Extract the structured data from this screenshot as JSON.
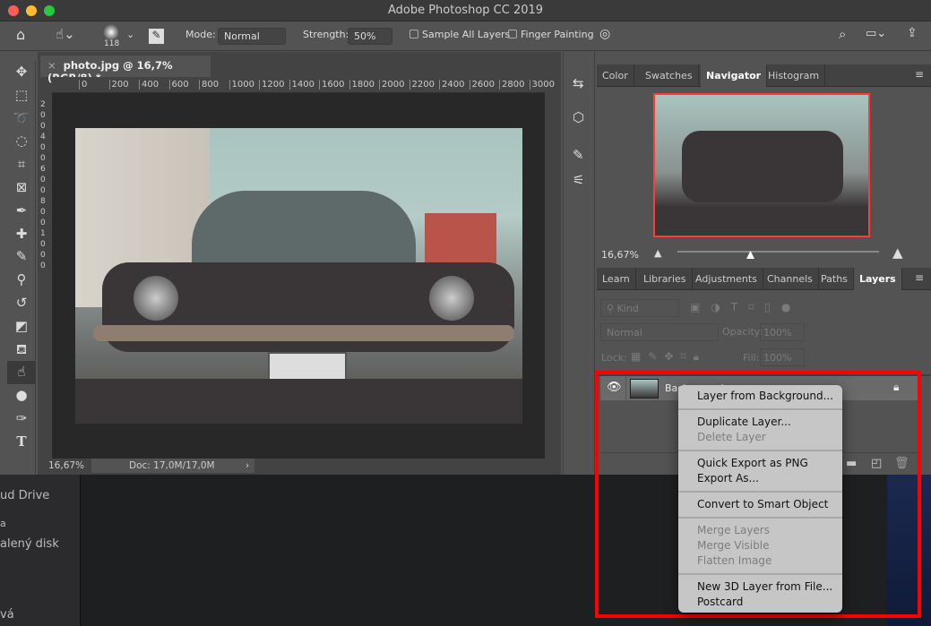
{
  "window": {
    "title": "Adobe Photoshop CC 2019"
  },
  "options": {
    "brush_size": "118",
    "mode_label": "Mode:",
    "mode_value": "Normal",
    "strength_label": "Strength:",
    "strength_value": "50%",
    "sample_all_layers": "Sample All Layers",
    "finger_painting": "Finger Painting"
  },
  "document": {
    "tab_title": "photo.jpg @ 16,7% (RGB/8) *",
    "ruler_h": [
      "0",
      "200",
      "400",
      "600",
      "800",
      "1000",
      "1200",
      "1400",
      "1600",
      "1800",
      "2000",
      "2200",
      "2400",
      "2600",
      "2800",
      "3000"
    ],
    "ruler_v": [
      "2",
      "0",
      "0",
      "4",
      "0",
      "0",
      "6",
      "0",
      "0",
      "8",
      "0",
      "0",
      "1",
      "0",
      "0",
      "0"
    ],
    "zoom": "16,67%",
    "doc_size": "Doc: 17,0M/17,0M"
  },
  "navigator": {
    "tabs": [
      "Color",
      "Swatches",
      "Navigator",
      "Histogram"
    ],
    "active": "Navigator",
    "zoom": "16,67%"
  },
  "layers": {
    "tabs": [
      "Learn",
      "Libraries",
      "Adjustments",
      "Channels",
      "Paths",
      "Layers"
    ],
    "active": "Layers",
    "filter_kind": "Kind",
    "blend_mode": "Normal",
    "opacity_label": "Opacity:",
    "opacity_value": "100%",
    "lock_label": "Lock:",
    "fill_label": "Fill:",
    "fill_value": "100%",
    "layer_name": "Background"
  },
  "context_menu": {
    "items": [
      {
        "label": "Layer from Background...",
        "enabled": true
      },
      {
        "label": "Duplicate Layer...",
        "enabled": true
      },
      {
        "label": "Delete Layer",
        "enabled": false
      },
      {
        "label": "Quick Export as PNG",
        "enabled": true
      },
      {
        "label": "Export As...",
        "enabled": true
      },
      {
        "label": "Convert to Smart Object",
        "enabled": true
      },
      {
        "label": "Merge Layers",
        "enabled": false
      },
      {
        "label": "Merge Visible",
        "enabled": false
      },
      {
        "label": "Flatten Image",
        "enabled": false
      },
      {
        "label": "New 3D Layer from File...",
        "enabled": true
      },
      {
        "label": "Postcard",
        "enabled": true
      }
    ]
  },
  "finder": {
    "items": [
      "ud Drive",
      "a",
      "alený disk",
      "vá"
    ]
  },
  "colors": {
    "highlight": "#ff0000",
    "panel": "#535353",
    "menu": "#c6c6c6"
  }
}
